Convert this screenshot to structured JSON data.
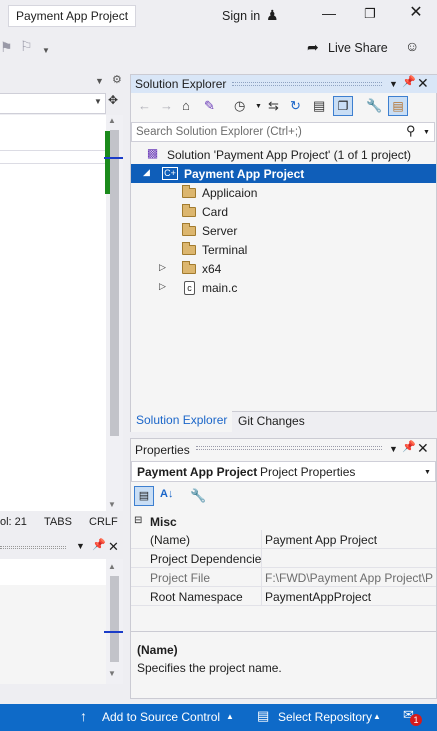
{
  "window": {
    "title": "Payment App Project",
    "sign_in": "Sign in",
    "live_share": "Live Share",
    "icons": {
      "minimize": "minimize-icon",
      "maximize": "restore-icon",
      "close": "close-icon"
    }
  },
  "editor": {
    "status": {
      "col": "ol: 21",
      "tabs": "TABS",
      "line_ending": "CRLF"
    }
  },
  "solution_explorer": {
    "title": "Solution Explorer",
    "search_placeholder": "Search Solution Explorer (Ctrl+;)",
    "solution_label": "Solution 'Payment App Project' (1 of 1 project)",
    "project_label": "Payment App Project",
    "items": [
      {
        "label": "Applicaion",
        "type": "folder",
        "expandable": false
      },
      {
        "label": "Card",
        "type": "folder",
        "expandable": false
      },
      {
        "label": "Server",
        "type": "folder",
        "expandable": false
      },
      {
        "label": "Terminal",
        "type": "folder",
        "expandable": false
      },
      {
        "label": "x64",
        "type": "folder",
        "expandable": true
      },
      {
        "label": "main.c",
        "type": "file",
        "expandable": true
      }
    ],
    "tabs": [
      "Solution Explorer",
      "Git Changes"
    ]
  },
  "properties": {
    "title": "Properties",
    "object_name": "Payment App Project",
    "object_type": "Project Properties",
    "category": "Misc",
    "rows": [
      {
        "key": "(Name)",
        "value": "Payment App Project",
        "readonly": false
      },
      {
        "key": "Project Dependencie",
        "value": "",
        "readonly": false
      },
      {
        "key": "Project File",
        "value": "F:\\FWD\\Payment App Project\\P",
        "readonly": true
      },
      {
        "key": "Root Namespace",
        "value": "PaymentAppProject",
        "readonly": false
      }
    ],
    "description_title": "(Name)",
    "description_text": "Specifies the project name."
  },
  "statusbar": {
    "add_to_source_control": "Add to Source Control",
    "select_repository": "Select Repository",
    "notification_count": "1",
    "accent_color": "#0e6ac8"
  }
}
